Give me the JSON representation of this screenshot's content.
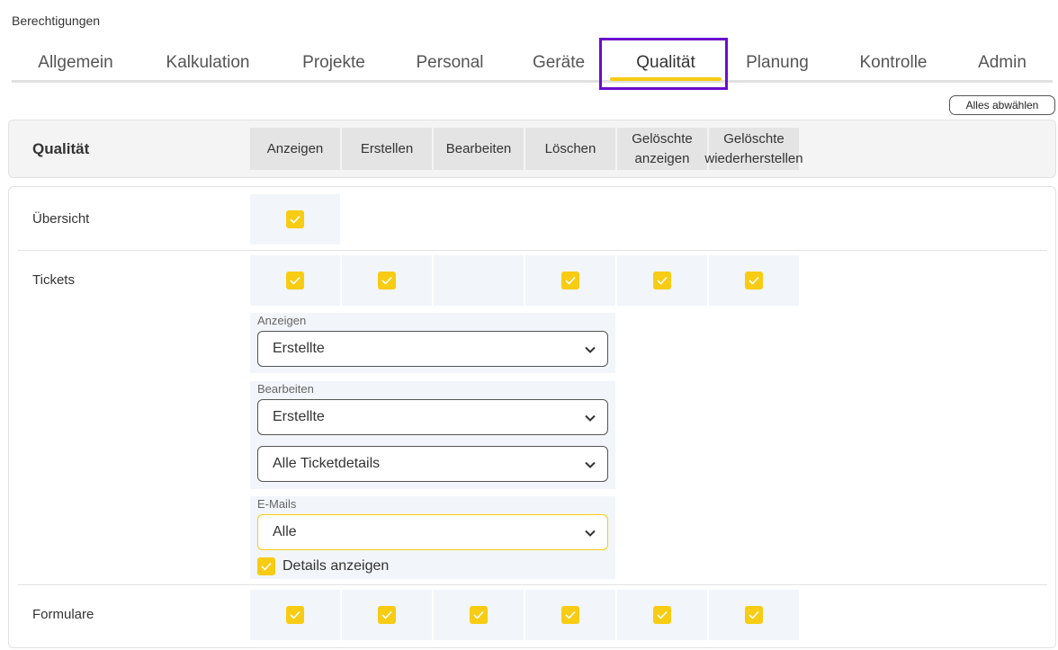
{
  "page": {
    "title": "Berechtigungen"
  },
  "tabs": [
    {
      "label": "Allgemein"
    },
    {
      "label": "Kalkulation"
    },
    {
      "label": "Projekte"
    },
    {
      "label": "Personal"
    },
    {
      "label": "Geräte"
    },
    {
      "label": "Qualität",
      "active": true
    },
    {
      "label": "Planung"
    },
    {
      "label": "Kontrolle"
    },
    {
      "label": "Admin"
    }
  ],
  "toolbar": {
    "deselect_all": "Alles abwählen"
  },
  "section": {
    "title": "Qualität"
  },
  "columns": [
    {
      "label": "Anzeigen"
    },
    {
      "label": "Erstellen"
    },
    {
      "label": "Bearbeiten"
    },
    {
      "label": "Löschen"
    },
    {
      "label_1": "Gelöschte",
      "label_2": "anzeigen"
    },
    {
      "label_1": "Gelöschte",
      "label_2": "wiederherstellen"
    }
  ],
  "rows": {
    "uebersicht": {
      "label": "Übersicht",
      "checks": [
        true
      ]
    },
    "tickets": {
      "label": "Tickets",
      "checks": [
        true,
        true,
        null,
        true,
        true,
        true
      ],
      "anzeigen": {
        "label": "Anzeigen",
        "value": "Erstellte"
      },
      "bearbeiten": {
        "label": "Bearbeiten",
        "value": "Erstellte",
        "value_2": "Alle Ticketdetails"
      },
      "emails": {
        "label": "E-Mails",
        "value": "Alle",
        "details_label": "Details anzeigen",
        "details_checked": true
      }
    },
    "formulare": {
      "label": "Formulare",
      "checks": [
        true,
        true,
        true,
        true,
        true,
        true
      ]
    }
  },
  "colors": {
    "accent": "#f7cc13",
    "highlight": "#6a0dcc"
  },
  "icons": {
    "check": "check-icon",
    "chevron": "chevron-down-icon"
  }
}
